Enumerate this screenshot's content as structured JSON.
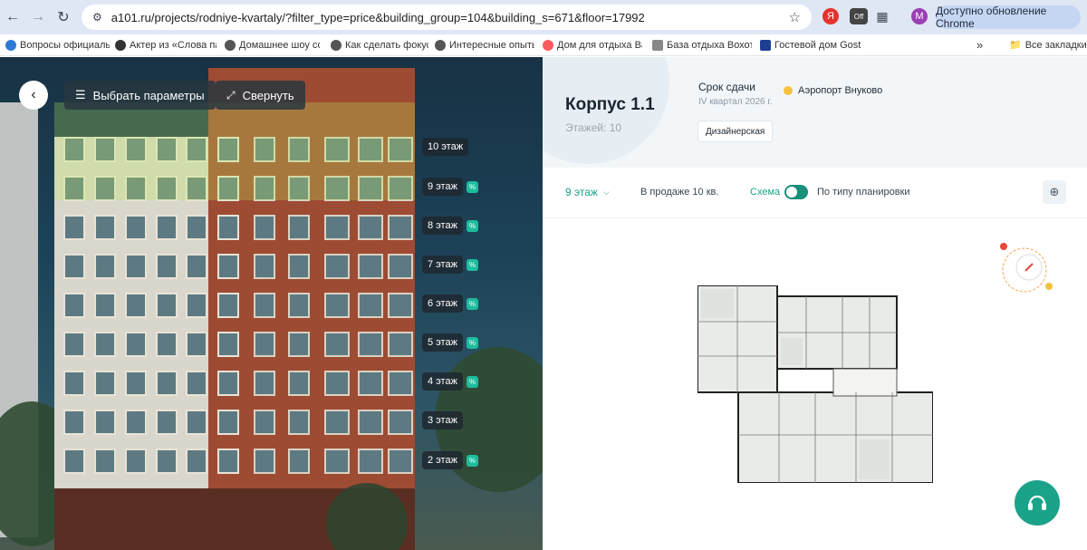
{
  "browser": {
    "url": "a101.ru/projects/rodniye-kvartaly/?filter_type=price&building_group=104&building_s=671&floor=17992",
    "profile_initial": "M",
    "update_label": "Доступно обновление Chrome",
    "ext_off_label": "Off",
    "ext_ya_label": "Я"
  },
  "bookmarks": {
    "items": [
      {
        "label": "Вопросы официаль..."
      },
      {
        "label": "Актер из «Слова па..."
      },
      {
        "label": "Домашнее шоу со..."
      },
      {
        "label": "Как сделать фокус..."
      },
      {
        "label": "Интересные опыты..."
      },
      {
        "label": "Дом для отдыха Ва..."
      },
      {
        "label": "База отдыха Вохотк..."
      },
      {
        "label": "Гостевой дом Gosti..."
      }
    ],
    "more": "»",
    "all_bookmarks": "Все закладки"
  },
  "photo": {
    "params_label": "Выбрать параметры",
    "collapse_label": "Свернуть",
    "floors": [
      {
        "label": "10 этаж",
        "discount": false
      },
      {
        "label": "9 этаж",
        "discount": true
      },
      {
        "label": "8 этаж",
        "discount": true
      },
      {
        "label": "7 этаж",
        "discount": true
      },
      {
        "label": "6 этаж",
        "discount": true
      },
      {
        "label": "5 этаж",
        "discount": true
      },
      {
        "label": "4 этаж",
        "discount": true
      },
      {
        "label": "3 этаж",
        "discount": false
      },
      {
        "label": "2 этаж",
        "discount": true
      }
    ],
    "discount_symbol": "%"
  },
  "building": {
    "title": "Корпус 1.1",
    "floors": "Этажей: 10",
    "deadline_label": "Срок сдачи",
    "deadline_value": "IV квартал 2026 г.",
    "airport": "Аэропорт Внуково",
    "finish_tag": "Дизайнерская"
  },
  "toolbar": {
    "floor_select": "9 этаж",
    "on_sale": "В продаже 10 кв.",
    "schema_label": "Схема",
    "by_layout_label": "По типу планировки"
  },
  "colors": {
    "accent": "#1ba389",
    "discount": "#1ebc9c"
  }
}
